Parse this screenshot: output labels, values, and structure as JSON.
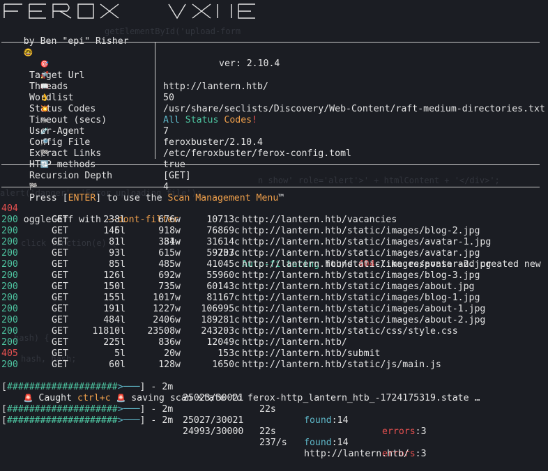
{
  "banner": {
    "byline": "by Ben \"epi\" Risher",
    "byline_emoji": "🤓",
    "version": "ver: 2.10.4"
  },
  "config": [
    {
      "icon": "🎯",
      "key": "Target Url",
      "value": "http://lantern.htb/"
    },
    {
      "icon": "🚀",
      "key": "Threads",
      "value": "50"
    },
    {
      "icon": "📖",
      "key": "Wordlist",
      "value": "/usr/share/seclists/Discovery/Web-Content/raft-medium-directories.txt"
    },
    {
      "icon": "👌",
      "key": "Status Codes",
      "value_all": "All",
      "value_status": "Status",
      "value_codes": "Codes",
      "value_bang": "!"
    },
    {
      "icon": "💥",
      "key": "Timeout (secs)",
      "value": "7"
    },
    {
      "icon": "🦡",
      "key": "User-Agent",
      "value": "feroxbuster/2.10.4"
    },
    {
      "icon": "💉",
      "key": "Config File",
      "value": "/etc/feroxbuster/ferox-config.toml"
    },
    {
      "icon": "🔎",
      "key": "Extract Links",
      "value": "true"
    },
    {
      "icon": "🏁",
      "key": "HTTP methods",
      "value": "[GET]"
    },
    {
      "icon": "🔃",
      "key": "Recursion Depth",
      "value": "4"
    }
  ],
  "press_enter": {
    "icon": "🏁",
    "pre": "Press [",
    "key": "ENTER",
    "mid": "] to use the ",
    "menu": "Scan Management Menu",
    "tm": "™"
  },
  "autofilter": {
    "status": "404",
    "method": "GET",
    "lines": "5l",
    "words": "31w",
    "chars": "207c",
    "msg1": "Auto-filtering",
    "msg2": " found ",
    "msg3": "404",
    "msg4": "-like response and created new",
    "wrap1": "oggle off with ",
    "wrap2": "--dont-filter"
  },
  "results": [
    {
      "status": "200",
      "method": "GET",
      "lines": "238l",
      "words": "676w",
      "chars": "10713c",
      "url": "http://lantern.htb/vacancies"
    },
    {
      "status": "200",
      "method": "GET",
      "lines": "146l",
      "words": "918w",
      "chars": "76869c",
      "url": "http://lantern.htb/static/images/blog-2.jpg"
    },
    {
      "status": "200",
      "method": "GET",
      "lines": "81l",
      "words": "384w",
      "chars": "31614c",
      "url": "http://lantern.htb/static/images/avatar-1.jpg"
    },
    {
      "status": "200",
      "method": "GET",
      "lines": "93l",
      "words": "615w",
      "chars": "59733c",
      "url": "http://lantern.htb/static/images/avatar.jpg"
    },
    {
      "status": "200",
      "method": "GET",
      "lines": "85l",
      "words": "485w",
      "chars": "41045c",
      "url": "http://lantern.htb/static/images/avatar-2.jpg"
    },
    {
      "status": "200",
      "method": "GET",
      "lines": "126l",
      "words": "692w",
      "chars": "55960c",
      "url": "http://lantern.htb/static/images/blog-3.jpg"
    },
    {
      "status": "200",
      "method": "GET",
      "lines": "150l",
      "words": "735w",
      "chars": "60143c",
      "url": "http://lantern.htb/static/images/about.jpg"
    },
    {
      "status": "200",
      "method": "GET",
      "lines": "155l",
      "words": "1017w",
      "chars": "81167c",
      "url": "http://lantern.htb/static/images/blog-1.jpg"
    },
    {
      "status": "200",
      "method": "GET",
      "lines": "191l",
      "words": "1227w",
      "chars": "106995c",
      "url": "http://lantern.htb/static/images/about-1.jpg"
    },
    {
      "status": "200",
      "method": "GET",
      "lines": "484l",
      "words": "2406w",
      "chars": "189281c",
      "url": "http://lantern.htb/static/images/about-2.jpg"
    },
    {
      "status": "200",
      "method": "GET",
      "lines": "11810l",
      "words": "23508w",
      "chars": "243203c",
      "url": "http://lantern.htb/static/css/style.css"
    },
    {
      "status": "200",
      "method": "GET",
      "lines": "225l",
      "words": "836w",
      "chars": "12049c",
      "url": "http://lantern.htb/"
    },
    {
      "status": "405",
      "method": "GET",
      "lines": "5l",
      "words": "20w",
      "chars": "153c",
      "url": "http://lantern.htb/submit"
    },
    {
      "status": "200",
      "method": "GET",
      "lines": "60l",
      "words": "128w",
      "chars": "1650c",
      "url": "http://lantern.htb/static/js/main.js"
    }
  ],
  "progress1": {
    "bar_open": "[",
    "bar_hash": "####################",
    "bar_arrow": ">───",
    "bar_close": "]",
    "dash": "-",
    "time": "2m",
    "count": "25023/30021",
    "secs": "22s",
    "found_label": "found",
    "found_val": ":14",
    "err_label": "errors",
    "err_val": ":3"
  },
  "caught": {
    "icon": "🚨",
    "pre": " Caught ",
    "key": "ctrl+c",
    "post": " saving scan state to ferox-http_lantern_htb_-1724175319.state …"
  },
  "progress2": {
    "bar_open": "[",
    "bar_hash": "####################",
    "bar_arrow": ">───",
    "bar_close": "]",
    "dash": "-",
    "time": "2m",
    "count": "25027/30021",
    "secs": "22s",
    "found_label": "found",
    "found_val": ":14",
    "err_label": "errors",
    "err_val": ":3"
  },
  "progress3": {
    "bar_open": "[",
    "bar_hash": "####################",
    "bar_arrow": ">───",
    "bar_close": "]",
    "dash": "-",
    "time": "2m",
    "count": "24993/30000",
    "rate": "237/s",
    "url": "http://lantern.htb/"
  },
  "ghost_text": [
    "getElementById('upload-form",
    "alert('danger', 'Error uploading file');",
    "n show' role='alert'>' + htmlContent + '</div>';",
    "click function(e) {",
    "hash) {",
    "hash, hash;"
  ]
}
